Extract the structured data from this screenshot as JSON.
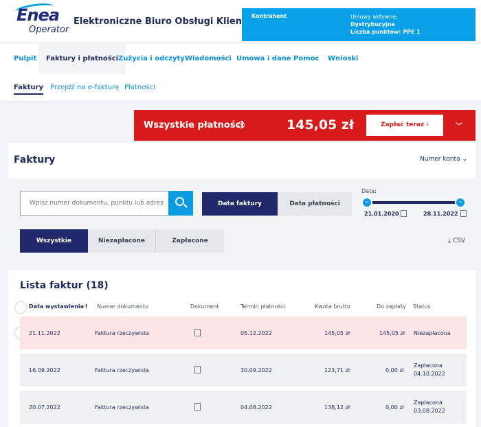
{
  "header": {
    "logo_main": "Enea",
    "logo_sub": "Operator",
    "app_title": "Elektroniczne Biuro Obsługi Klienta",
    "contractor_label": "Kontrahent",
    "contracts_label": "Umowy aktywne:",
    "contracts_value": "Dystrybucyjna",
    "points_label": "Liczba punktów: PPE 1"
  },
  "nav": {
    "items": [
      "Pulpit",
      "Faktury i płatności",
      "Zużycia i odczyty",
      "Wiadomości",
      "Umowa i dane",
      "Pomoc",
      "Wnioski"
    ],
    "active": "Faktury i płatności"
  },
  "subnav": {
    "items": [
      "Faktury",
      "Przejdź na e-fakturę",
      "Płatności"
    ],
    "active": "Faktury"
  },
  "payments": {
    "label": "Wszystkie płatności",
    "info_icon": "?",
    "amount": "145,05 zł",
    "pay_button": "Zapłać teraz ›",
    "expand_icon": "chevron-down-icon"
  },
  "invoices_panel": {
    "title": "Faktury",
    "account_select": "Numer konta ⌄",
    "search_placeholder": "Wpisz numer dokumentu, punktu lub adres",
    "date_toggle": [
      "Data faktury",
      "Data płatności"
    ],
    "date_toggle_active": "Data faktury",
    "date_label": "Data:",
    "date_from": "21.01.2020",
    "date_to": "28.11.2022",
    "status_filter": [
      "Wszystkie",
      "Niezapłacone",
      "Zapłacone"
    ],
    "status_filter_active": "Wszystkie",
    "csv_label": "⤓ CSV"
  },
  "list": {
    "title": "Lista faktur (18)",
    "columns": [
      "Data wystawienia",
      "Numer dokumentu",
      "Dokument",
      "Termin płatności",
      "Kwota brutto",
      "Do zapłaty",
      "Status"
    ],
    "sort_icon": "↑",
    "rows": [
      {
        "date": "21.11.2022",
        "number": "Faktura rzeczywista",
        "due": "05.12.2022",
        "gross": "145,05 zł",
        "to_pay": "145,05 zł",
        "status": "Niezapłacona",
        "status_date": ""
      },
      {
        "date": "16.09.2022",
        "number": "Faktura rzeczywista",
        "due": "30.09.2022",
        "gross": "123,71 zł",
        "to_pay": "0,00 zł",
        "status": "Zapłacona",
        "status_date": "04.10.2022"
      },
      {
        "date": "20.07.2022",
        "number": "Faktura rzeczywista",
        "due": "04.08.2022",
        "gross": "138,12 zł",
        "to_pay": "0,00 zł",
        "status": "Zapłacona",
        "status_date": "03.08.2022"
      }
    ]
  },
  "colors": {
    "brand_navy": "#1f2a5c",
    "accent_blue": "#0a9be0",
    "alert_red": "#d91a1a",
    "unpaid_row": "#fde4e6"
  }
}
